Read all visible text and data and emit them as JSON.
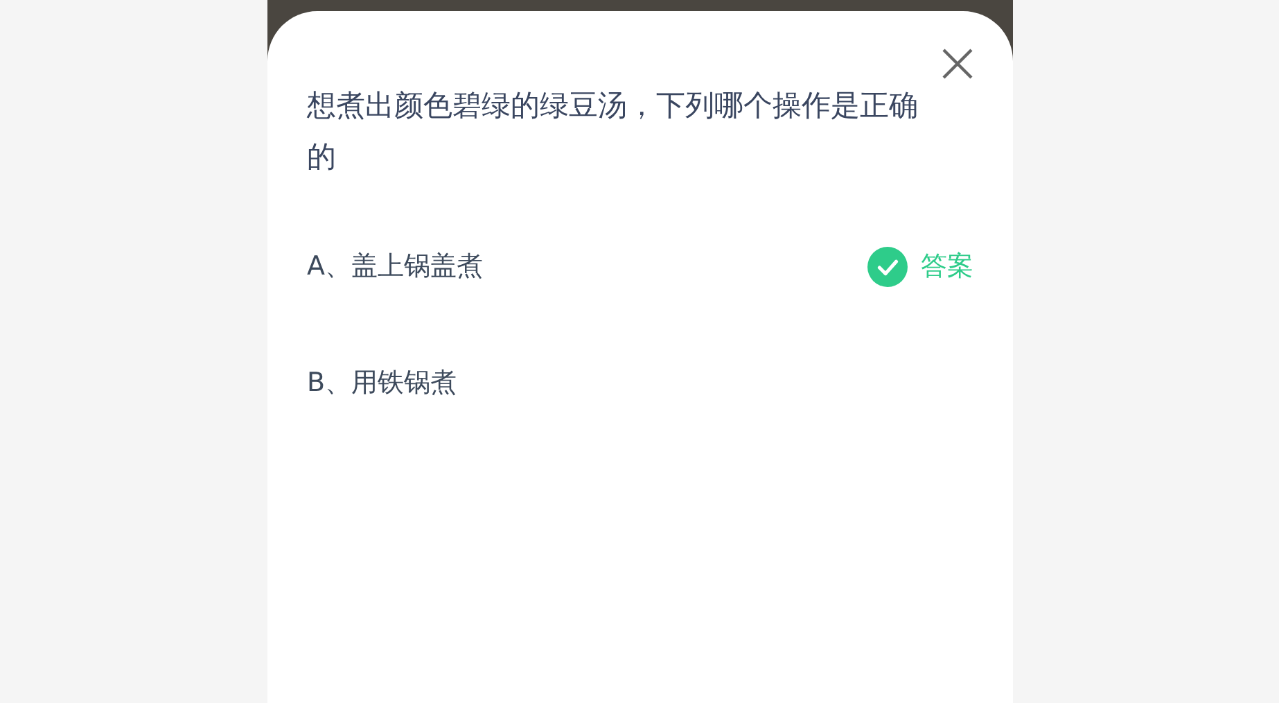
{
  "question": "想煮出颜色碧绿的绿豆汤，下列哪个操作是正确的",
  "options": [
    {
      "label": "A、盖上锅盖煮",
      "correct": true,
      "answer_tag": "答案"
    },
    {
      "label": "B、用铁锅煮",
      "correct": false
    }
  ]
}
